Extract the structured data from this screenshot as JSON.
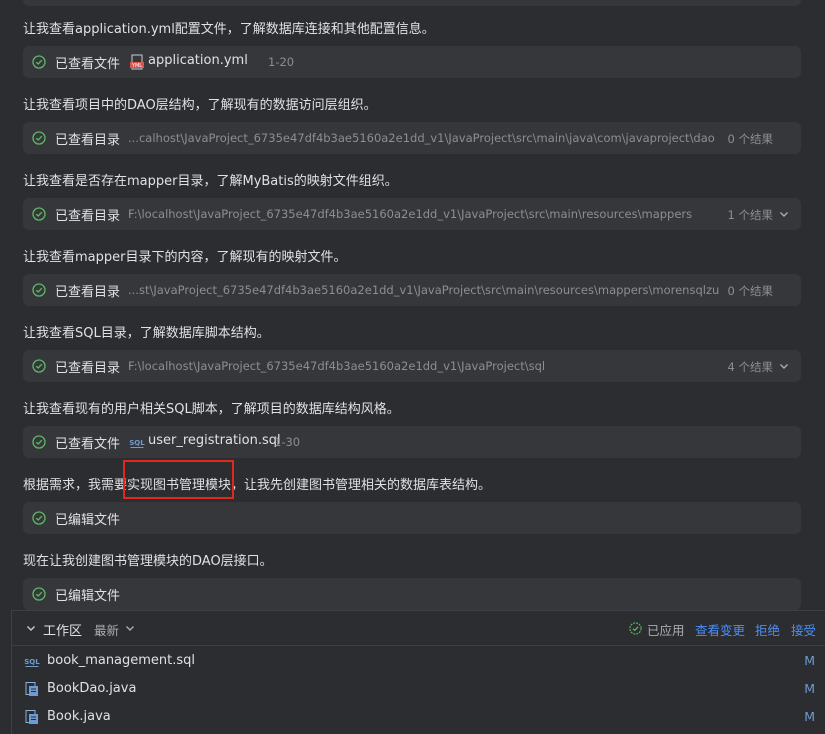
{
  "conversation": {
    "m1": "让我查看application.yml配置文件，了解数据库连接和其他配置信息。",
    "c1": {
      "action": "已查看文件",
      "file": "application.yml",
      "range": "1-20"
    },
    "m2": "让我查看项目中的DAO层结构，了解现有的数据访问层组织。",
    "c2": {
      "action": "已查看目录",
      "path": "...calhost\\JavaProject_6735e47df4b3ae5160a2e1dd_v1\\JavaProject\\src\\main\\java\\com\\javaproject\\dao",
      "count": "0 个结果"
    },
    "m3": "让我查看是否存在mapper目录，了解MyBatis的映射文件组织。",
    "c3": {
      "action": "已查看目录",
      "path": "F:\\localhost\\JavaProject_6735e47df4b3ae5160a2e1dd_v1\\JavaProject\\src\\main\\resources\\mappers",
      "count": "1 个结果"
    },
    "m4": "让我查看mapper目录下的内容，了解现有的映射文件。",
    "c4": {
      "action": "已查看目录",
      "path": "...st\\JavaProject_6735e47df4b3ae5160a2e1dd_v1\\JavaProject\\src\\main\\resources\\mappers\\morensqlzu",
      "count": "0 个结果"
    },
    "m5": "让我查看SQL目录，了解数据库脚本结构。",
    "c5": {
      "action": "已查看目录",
      "path": "F:\\localhost\\JavaProject_6735e47df4b3ae5160a2e1dd_v1\\JavaProject\\sql",
      "count": "4 个结果"
    },
    "m6": "让我查看现有的用户相关SQL脚本，了解项目的数据库结构风格。",
    "c6": {
      "action": "已查看文件",
      "file": "user_registration.sql",
      "range": "1-30"
    },
    "m7": "根据需求，我需要实现图书管理模块，让我先创建图书管理相关的数据库表结构。",
    "c7": {
      "action": "已编辑文件"
    },
    "m8": "现在让我创建图书管理模块的DAO层接口。",
    "c8": {
      "action": "已编辑文件"
    }
  },
  "workspace": {
    "title": "工作区",
    "sort": "最新",
    "applied": "已应用",
    "view_changes": "查看变更",
    "reject": "拒绝",
    "accept": "接受",
    "files": [
      {
        "name": "book_management.sql",
        "status": "M",
        "icon": "sql-file-icon"
      },
      {
        "name": "BookDao.java",
        "status": "M",
        "icon": "java-file-icon"
      },
      {
        "name": "Book.java",
        "status": "M",
        "icon": "java-file-icon"
      }
    ]
  },
  "colors": {
    "background": "#2b2d30",
    "card": "#35373b",
    "check": "#5fb865",
    "link": "#4c8df6",
    "highlight": "#e0281f"
  }
}
